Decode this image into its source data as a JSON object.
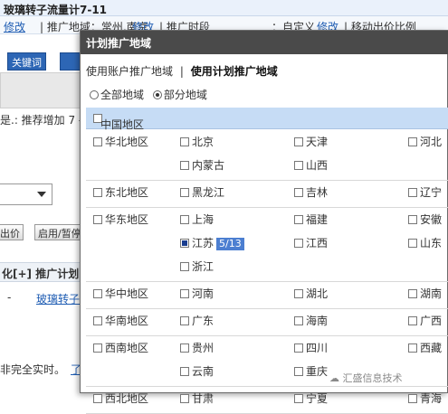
{
  "background": {
    "title": "玻璃转子流量计7-11",
    "info_items": [
      {
        "text": "| 推广地域：常州,南京",
        "link": "修改"
      },
      {
        "text": "| 推广时段",
        "link": ""
      },
      {
        "text": "：自定义",
        "link": "修改"
      },
      {
        "text": "| 移动出价比例",
        "link": ""
      }
    ],
    "edit_link": "修改",
    "tab_label": "关键词",
    "hint_text": "是.: 推荐增加 7 -",
    "btn_bid": "出价",
    "btn_enable": "启用/暂停",
    "col_header": "化[+]  推广计划",
    "row_cell": "玻璃转子",
    "row_dash": "-",
    "footer_text": "非完全实时。",
    "footer_link": "了"
  },
  "dialog": {
    "title": "计划推广地域",
    "tab_account": "使用账户推广地域",
    "tab_separator": "|",
    "tab_plan": "使用计划推广地域",
    "radio_all": "全部地域",
    "radio_partial": "部分地域",
    "china": "中国地区",
    "regions": [
      {
        "name": "华北地区",
        "provinces": [
          [
            "北京",
            "天津",
            "河北"
          ],
          [
            "内蒙古",
            "山西"
          ]
        ]
      },
      {
        "name": "东北地区",
        "provinces": [
          [
            "黑龙江",
            "吉林",
            "辽宁"
          ]
        ]
      },
      {
        "name": "华东地区",
        "provinces": [
          [
            "上海",
            "福建",
            "安徽"
          ],
          [
            "江苏",
            "江西",
            "山东"
          ],
          [
            "浙江"
          ]
        ]
      },
      {
        "name": "华中地区",
        "provinces": [
          [
            "河南",
            "湖北",
            "湖南"
          ]
        ]
      },
      {
        "name": "华南地区",
        "provinces": [
          [
            "广东",
            "海南",
            "广西"
          ]
        ]
      },
      {
        "name": "西南地区",
        "provinces": [
          [
            "贵州",
            "四川",
            "西藏"
          ],
          [
            "云南",
            "重庆"
          ]
        ]
      },
      {
        "name": "西北地区",
        "provinces": [
          [
            "甘肃",
            "宁夏",
            "青海"
          ]
        ]
      }
    ],
    "jiangsu_badge": "5/13"
  },
  "watermark": "汇盛信息技术"
}
